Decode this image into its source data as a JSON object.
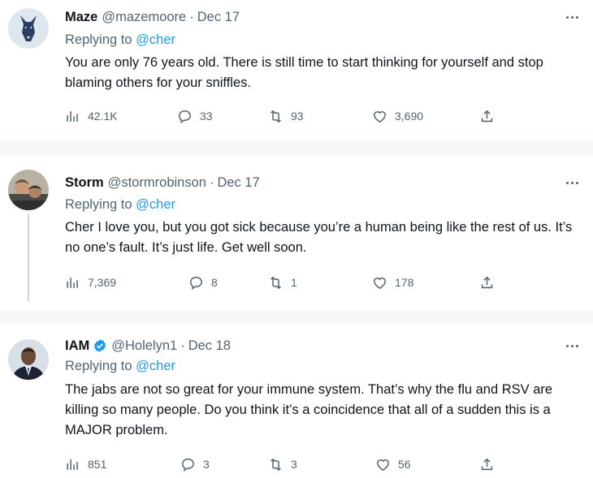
{
  "replying_to_label": "Replying to",
  "tweets": [
    {
      "name": "Maze",
      "handle": "@mazemoore",
      "date": "Dec 17",
      "reply_to": "@cher",
      "text": "You are only 76 years old. There is still time to start thinking for yourself and stop blaming others for your sniffles.",
      "views": "42.1K",
      "replies": "33",
      "retweets": "93",
      "likes": "3,690",
      "avatar_icon": "doberman-logo-avatar"
    },
    {
      "name": "Storm",
      "handle": "@stormrobinson",
      "date": "Dec 17",
      "reply_to": "@cher",
      "text": "Cher I love you, but you got sick because you’re a human being like the rest of us. It’s no one’s fault. It’s just life. Get well soon.",
      "views": "7,369",
      "replies": "8",
      "retweets": "1",
      "likes": "178",
      "avatar_icon": "photo-avatar"
    },
    {
      "name": "IAM",
      "handle": "@Holelyn1",
      "date": "Dec 18",
      "reply_to": "@cher",
      "verified": true,
      "text": "The jabs are not so great for your immune system. That’s why the flu and RSV are killing so many people.  Do you think it’s a coincidence that all of a sudden this is a MAJOR problem.",
      "views": "851",
      "replies": "3",
      "retweets": "3",
      "likes": "56",
      "avatar_icon": "man-in-suit-avatar"
    }
  ],
  "colors": {
    "text": "#0f1419",
    "secondary": "#536471",
    "link": "#1d9bf0",
    "separator": "#f7f9f9",
    "verified": "#1d9bf0"
  }
}
